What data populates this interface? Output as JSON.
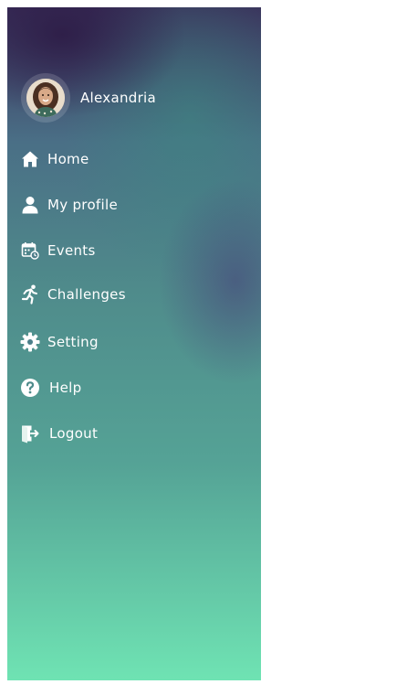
{
  "user": {
    "name": "Alexandria"
  },
  "menu": {
    "items": [
      {
        "label": "Home",
        "icon": "home-icon"
      },
      {
        "label": "My profile",
        "icon": "user-icon"
      },
      {
        "label": "Events",
        "icon": "calendar-icon"
      },
      {
        "label": "Challenges",
        "icon": "running-icon"
      },
      {
        "label": "Setting",
        "icon": "gear-icon"
      },
      {
        "label": "Help",
        "icon": "help-icon"
      },
      {
        "label": "Logout",
        "icon": "logout-icon"
      }
    ]
  },
  "colors": {
    "gradient_top": "#3a2e5a",
    "gradient_mid": "#4f8b8b",
    "gradient_bottom": "#6fe3b3",
    "text": "#ffffff"
  }
}
